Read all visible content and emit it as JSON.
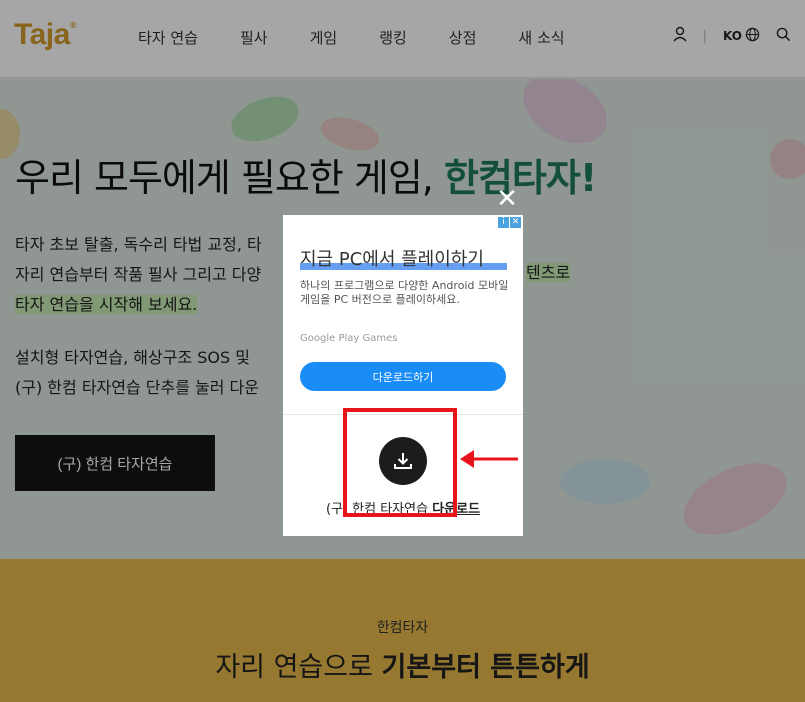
{
  "header": {
    "logo": "Taja",
    "logo_mark": "®",
    "nav": [
      "타자 연습",
      "필사",
      "게임",
      "랭킹",
      "상점",
      "새 소식"
    ],
    "user_icon": "user-icon",
    "lang": "KO",
    "globe_icon": "globe-icon",
    "search_icon": "search-icon"
  },
  "hero": {
    "title_plain": "우리 모두에게 필요한 게임,",
    "title_accent": "한컴타자!",
    "para1_line1": "타자 초보 탈출, 독수리 타법 교정, 타",
    "para1_line2": "자리 연습부터 작품 필사 그리고 다양",
    "para1_line3": "타자 연습을 시작해 보세요.",
    "para1_right": "텐츠로",
    "para2_line1": "설치형 타자연습, 해상구조 SOS 및",
    "para2_line2": "(구) 한컴 타자연습 단추를 눌러 다운",
    "old_button": "(구) 한컴 타자연습"
  },
  "lower": {
    "sub": "한컴타자",
    "big_plain": "자리 연습으로",
    "big_bold": "기본부터 튼튼하게"
  },
  "modal": {
    "close_glyph": "✕",
    "ad_title": "지금 PC에서 플레이하기",
    "ad_desc": "하나의 프로그램으로 다양한 Android 모바일 게임을 PC 버전으로 플레이하세요.",
    "ad_source": "Google Play Games",
    "ad_button": "다운로드하기",
    "download_prefix": "(구) 한컴 타자연습",
    "download_link": "다운로드"
  },
  "colors": {
    "brand": "#d39a2b",
    "accent_green": "#1f7a5e",
    "highlight": "#c8ebb4",
    "annotation_red": "#e8141b",
    "ad_blue": "#1a8cf5"
  }
}
